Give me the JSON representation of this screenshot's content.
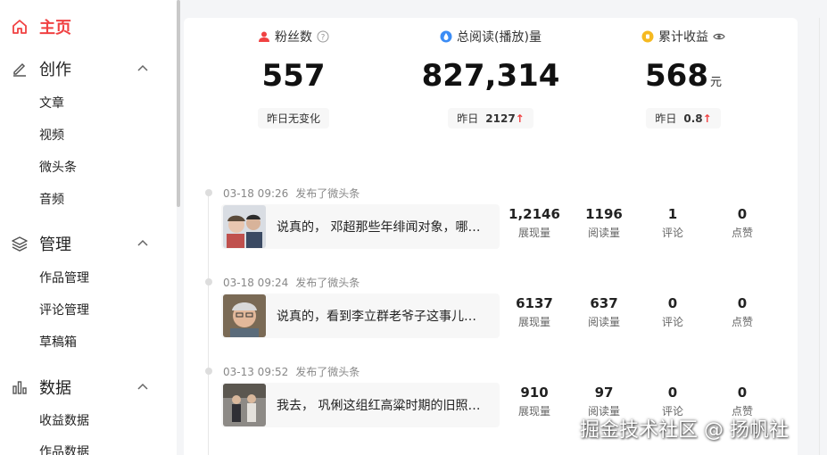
{
  "sidebar": {
    "home": "主页",
    "create": {
      "label": "创作",
      "items": [
        "文章",
        "视频",
        "微头条",
        "音频"
      ]
    },
    "manage": {
      "label": "管理",
      "items": [
        "作品管理",
        "评论管理",
        "草稿箱"
      ]
    },
    "data": {
      "label": "数据",
      "items": [
        "收益数据",
        "作品数据"
      ]
    }
  },
  "stats": [
    {
      "label": "粉丝数",
      "value": "557",
      "unit": "",
      "sub_text": "昨日无变化",
      "sub_value": "",
      "trend": ""
    },
    {
      "label": "总阅读(播放)量",
      "value": "827,314",
      "unit": "",
      "sub_text": "昨日",
      "sub_value": "2127",
      "trend": "↑"
    },
    {
      "label": "累计收益",
      "value": "568",
      "unit": "元",
      "sub_text": "昨日",
      "sub_value": "0.8",
      "trend": "↑"
    }
  ],
  "metric_labels": [
    "展现量",
    "阅读量",
    "评论",
    "点赞"
  ],
  "feed": [
    {
      "time": "03-18 09:26",
      "action": "发布了微头条",
      "text": "说真的， 邓超那些年绯闻对象，哪个不是大美女",
      "metrics": [
        "1,2146",
        "1196",
        "1",
        "0"
      ]
    },
    {
      "time": "03-18 09:24",
      "action": "发布了微头条",
      "text": "说真的，看到李立群老爷子这事儿，心里挺不是滋味",
      "metrics": [
        "6137",
        "637",
        "0",
        "0"
      ]
    },
    {
      "time": "03-13 09:52",
      "action": "发布了微头条",
      "text": "我去， 巩俐这组红高粱时期的旧照太美了",
      "metrics": [
        "910",
        "97",
        "0",
        "0"
      ]
    }
  ],
  "watermark": "掘金技术社区 @ 扬帆社",
  "colors": {
    "accent": "#f04142",
    "blue": "#3b8cf5",
    "gold": "#f5b921"
  }
}
